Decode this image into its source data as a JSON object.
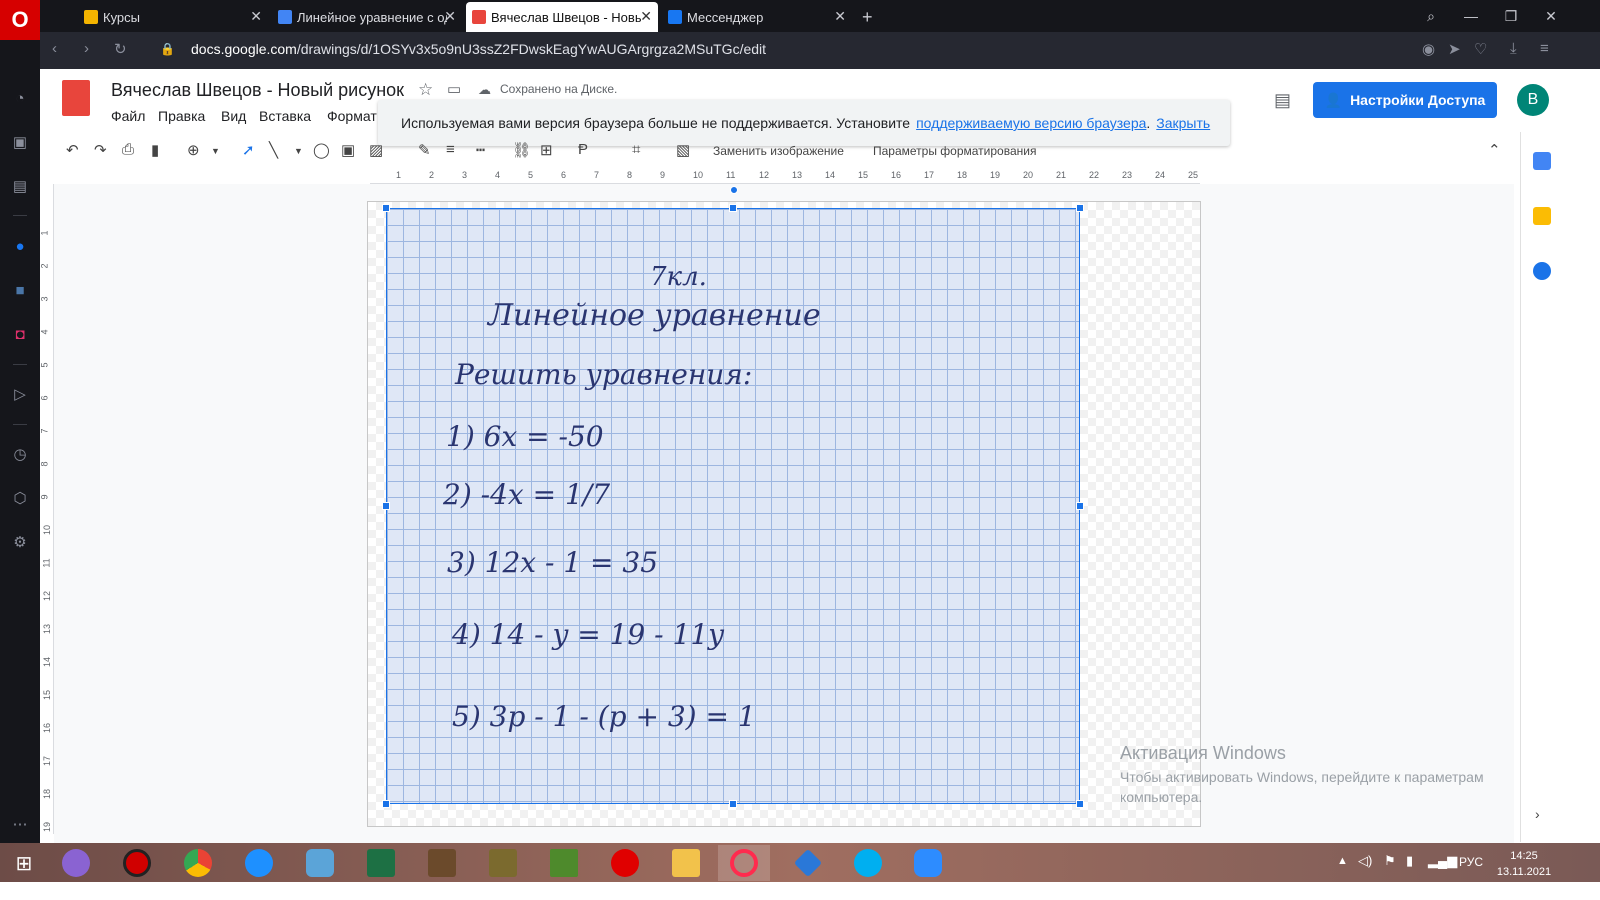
{
  "browser": {
    "tabs": [
      {
        "label": "Курсы",
        "icon_color": "#f4b400",
        "close": "✕"
      },
      {
        "label": "Линейное уравнение с од",
        "icon_color": "#4285f4",
        "close": "✕"
      },
      {
        "label": "Вячеслав Швецов - Новы",
        "icon_color": "#e8453c",
        "close": "✕"
      },
      {
        "label": "Мессенджер",
        "icon_color": "#1877f2",
        "close": "✕"
      }
    ],
    "new_tab": "+",
    "url_host": "docs.google.com",
    "url_path": "/drawings/d/1OSYv3x5o9nU3ssZ2FDwskEagYwAUGArgrgza2MSuTGc/edit"
  },
  "doc": {
    "title": "Вячеслав Швецов - Новый рисунок",
    "saved_status": "Сохранено на Диске.",
    "menu": [
      "Файл",
      "Правка",
      "Вид",
      "Вставка",
      "Формат"
    ],
    "share_label": "Настройки Доступа",
    "avatar_letter": "В"
  },
  "banner": {
    "text": "Используемая вами версия браузера больше не поддерживается. Установите",
    "link": "поддерживаемую версию браузера",
    "close": "Закрыть"
  },
  "toolbar": {
    "replace_image": "Заменить изображение",
    "format_options": "Параметры форматирования"
  },
  "ruler": {
    "top": [
      "1",
      "2",
      "3",
      "4",
      "5",
      "6",
      "7",
      "8",
      "9",
      "10",
      "11",
      "12",
      "13",
      "14",
      "15",
      "16",
      "17",
      "18",
      "19",
      "20",
      "21",
      "22",
      "23",
      "24",
      "25"
    ],
    "left": [
      "1",
      "2",
      "3",
      "4",
      "5",
      "6",
      "7",
      "8",
      "9",
      "10",
      "11",
      "12",
      "13",
      "14",
      "15",
      "16",
      "17",
      "18",
      "19"
    ]
  },
  "photo": {
    "lines": [
      "7кл.",
      "Линейное уравнение",
      "Решить уравнения:",
      "1)   6x = -50",
      "2)   -4x = 1/7",
      "3)   12x - 1 = 35",
      "4)   14 - y = 19 - 11y",
      "5)   3p - 1 - (p + 3) = 1"
    ]
  },
  "watermark": {
    "title": "Активация Windows",
    "text": "Чтобы активировать Windows, перейдите к параметрам компьютера."
  },
  "system": {
    "lang": "РУС",
    "time": "14:25",
    "date": "13.11.2021"
  }
}
